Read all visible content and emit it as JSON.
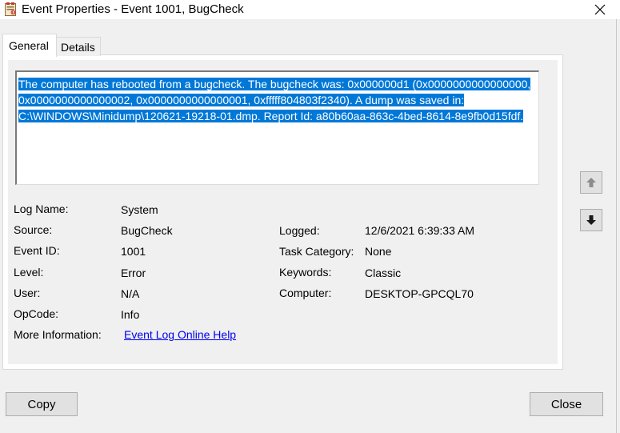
{
  "window": {
    "title": "Event Properties - Event 1001, BugCheck"
  },
  "icons": {
    "app": "event-viewer-icon",
    "close": "close-icon",
    "scroll_up": "up-arrow-icon",
    "scroll_down": "down-arrow-icon"
  },
  "tabs": [
    {
      "label": "General",
      "selected": true
    },
    {
      "label": "Details",
      "selected": false
    }
  ],
  "description": {
    "text": "The computer has rebooted from a bugcheck.  The bugcheck was: 0x000000d1 (0x0000000000000000, 0x0000000000000002, 0x0000000000000001, 0xfffff804803f2340). A dump was saved in: C:\\WINDOWS\\Minidump\\120621-19218-01.dmp. Report Id: a80b60aa-863c-4bed-8614-8e9fb0d15fdf.",
    "selected": true
  },
  "fields": {
    "log_name": {
      "label": "Log Name:",
      "value": "System"
    },
    "source": {
      "label": "Source:",
      "value": "BugCheck"
    },
    "logged": {
      "label": "Logged:",
      "value": "12/6/2021 6:39:33 AM"
    },
    "event_id": {
      "label": "Event ID:",
      "value": "1001"
    },
    "task_category": {
      "label": "Task Category:",
      "value": "None"
    },
    "level": {
      "label": "Level:",
      "value": "Error"
    },
    "keywords": {
      "label": "Keywords:",
      "value": "Classic"
    },
    "user": {
      "label": "User:",
      "value": "N/A"
    },
    "computer": {
      "label": "Computer:",
      "value": "DESKTOP-GPCQL70"
    },
    "opcode": {
      "label": "OpCode:",
      "value": "Info"
    },
    "more_info": {
      "label": "More Information:",
      "link": "Event Log Online Help"
    }
  },
  "buttons": {
    "copy": "Copy",
    "close": "Close"
  },
  "colors": {
    "selection": "#0078d7",
    "link": "#0000ee",
    "window_bg": "#f0f0f0"
  }
}
